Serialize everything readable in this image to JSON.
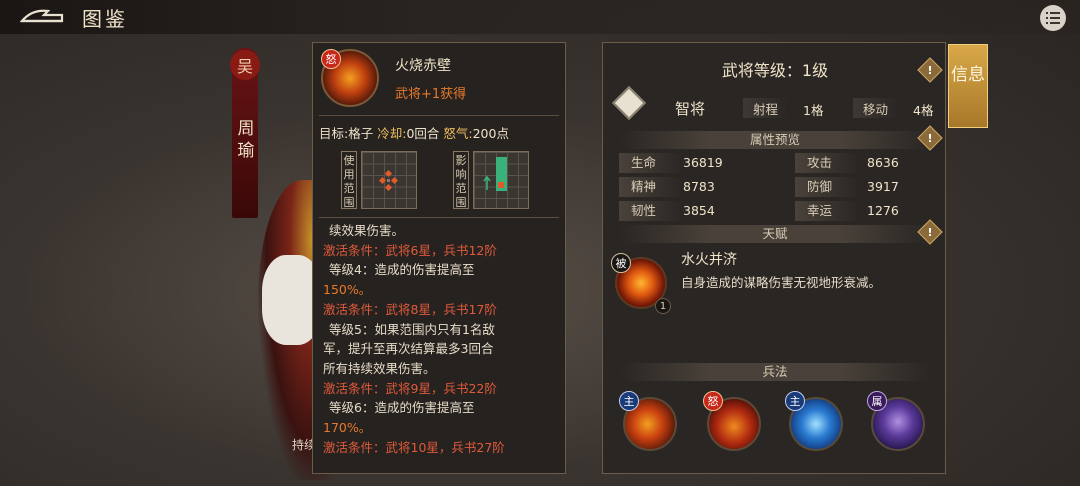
{
  "header": {
    "title": "图鉴"
  },
  "hero": {
    "faction": "吴",
    "name": "周瑜",
    "caption": "持续"
  },
  "skill": {
    "badge": "怒",
    "name": "火烧赤壁",
    "source": "武将+1获得",
    "target_label": "目标:",
    "target_value": "格子",
    "cooldown_label": "冷却:",
    "cooldown_value": "0回合",
    "rage_label": "怒气:",
    "rage_value": "200点",
    "use_range_label": "使用范围",
    "effect_range_label": "影响范围",
    "desc": {
      "partial": "续效果伤害。",
      "cond1": "激活条件：武将6星，兵书12阶",
      "lv4_a": "等级4：造成的伤害提高至",
      "lv4_b": "150%。",
      "cond2": "激活条件：武将8星，兵书17阶",
      "lv5_a": "等级5：如果范围内只有1名敌",
      "lv5_b": "军，提升至再次结算最多3回合",
      "lv5_c": "所有持续效果伤害。",
      "cond3": "激活条件：武将9星，兵书22阶",
      "lv6_a": "等级6：造成的伤害提高至",
      "lv6_b": "170%。",
      "cond4": "激活条件：武将10星，兵书27阶"
    }
  },
  "info": {
    "level_title": "武将等级：1级",
    "class_name": "智将",
    "range_label": "射程",
    "range_value": "1格",
    "move_label": "移动",
    "move_value": "4格",
    "attr_section": "属性预览",
    "attrs": [
      {
        "label": "生命",
        "value": "36819"
      },
      {
        "label": "攻击",
        "value": "8636"
      },
      {
        "label": "精神",
        "value": "8783"
      },
      {
        "label": "防御",
        "value": "3917"
      },
      {
        "label": "韧性",
        "value": "3854"
      },
      {
        "label": "幸运",
        "value": "1276"
      }
    ],
    "talent_section": "天赋",
    "talent": {
      "badge": "被",
      "name": "水火并济",
      "desc": "自身造成的谋略伤害无视地形衰减。",
      "level": "1"
    },
    "tactics_section": "兵法",
    "tactics": [
      {
        "badge": "主",
        "icon": "fire-wave-icon"
      },
      {
        "badge": "怒",
        "icon": "burning-ship-icon"
      },
      {
        "badge": "主",
        "icon": "water-vortex-icon"
      },
      {
        "badge": "属",
        "icon": "shadow-general-icon"
      }
    ],
    "hint": "!"
  },
  "side_tab": {
    "label": "信息"
  }
}
